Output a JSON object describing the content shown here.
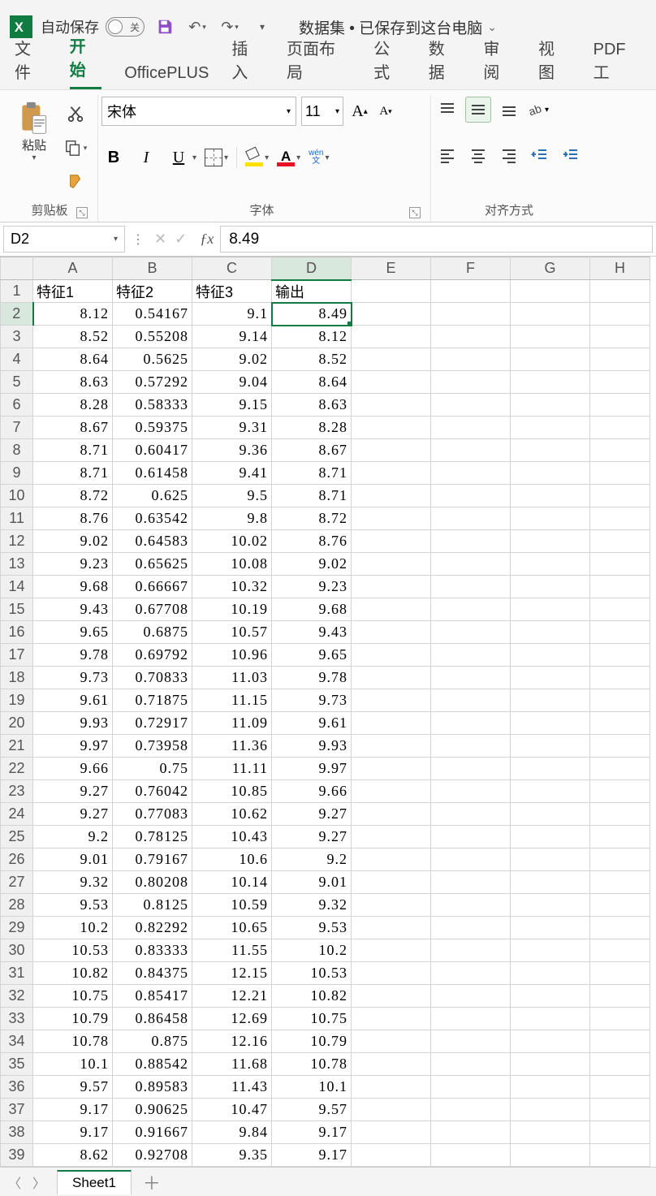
{
  "title": {
    "autosave_label": "自动保存",
    "autosave_state": "关",
    "doc_name": "数据集 • 已保存到这台电脑"
  },
  "tabs": {
    "file": "文件",
    "home": "开始",
    "officeplus": "OfficePLUS",
    "insert": "插入",
    "layout": "页面布局",
    "formulas": "公式",
    "data": "数据",
    "review": "审阅",
    "view": "视图",
    "pdf": "PDF工"
  },
  "ribbon": {
    "clipboard": {
      "paste": "粘贴",
      "group": "剪贴板"
    },
    "font": {
      "name": "宋体",
      "size": "11",
      "group": "字体",
      "wen_top": "wén",
      "wen_bot": "文"
    },
    "align": {
      "group": "对齐方式"
    }
  },
  "namebox": "D2",
  "formula": "8.49",
  "columns": [
    "A",
    "B",
    "C",
    "D",
    "E",
    "F",
    "G",
    "H"
  ],
  "headers": [
    "特征1",
    "特征2",
    "特征3",
    "输出"
  ],
  "rows": [
    [
      "8.12",
      "0.54167",
      "9.1",
      "8.49"
    ],
    [
      "8.52",
      "0.55208",
      "9.14",
      "8.12"
    ],
    [
      "8.64",
      "0.5625",
      "9.02",
      "8.52"
    ],
    [
      "8.63",
      "0.57292",
      "9.04",
      "8.64"
    ],
    [
      "8.28",
      "0.58333",
      "9.15",
      "8.63"
    ],
    [
      "8.67",
      "0.59375",
      "9.31",
      "8.28"
    ],
    [
      "8.71",
      "0.60417",
      "9.36",
      "8.67"
    ],
    [
      "8.71",
      "0.61458",
      "9.41",
      "8.71"
    ],
    [
      "8.72",
      "0.625",
      "9.5",
      "8.71"
    ],
    [
      "8.76",
      "0.63542",
      "9.8",
      "8.72"
    ],
    [
      "9.02",
      "0.64583",
      "10.02",
      "8.76"
    ],
    [
      "9.23",
      "0.65625",
      "10.08",
      "9.02"
    ],
    [
      "9.68",
      "0.66667",
      "10.32",
      "9.23"
    ],
    [
      "9.43",
      "0.67708",
      "10.19",
      "9.68"
    ],
    [
      "9.65",
      "0.6875",
      "10.57",
      "9.43"
    ],
    [
      "9.78",
      "0.69792",
      "10.96",
      "9.65"
    ],
    [
      "9.73",
      "0.70833",
      "11.03",
      "9.78"
    ],
    [
      "9.61",
      "0.71875",
      "11.15",
      "9.73"
    ],
    [
      "9.93",
      "0.72917",
      "11.09",
      "9.61"
    ],
    [
      "9.97",
      "0.73958",
      "11.36",
      "9.93"
    ],
    [
      "9.66",
      "0.75",
      "11.11",
      "9.97"
    ],
    [
      "9.27",
      "0.76042",
      "10.85",
      "9.66"
    ],
    [
      "9.27",
      "0.77083",
      "10.62",
      "9.27"
    ],
    [
      "9.2",
      "0.78125",
      "10.43",
      "9.27"
    ],
    [
      "9.01",
      "0.79167",
      "10.6",
      "9.2"
    ],
    [
      "9.32",
      "0.80208",
      "10.14",
      "9.01"
    ],
    [
      "9.53",
      "0.8125",
      "10.59",
      "9.32"
    ],
    [
      "10.2",
      "0.82292",
      "10.65",
      "9.53"
    ],
    [
      "10.53",
      "0.83333",
      "11.55",
      "10.2"
    ],
    [
      "10.82",
      "0.84375",
      "12.15",
      "10.53"
    ],
    [
      "10.75",
      "0.85417",
      "12.21",
      "10.82"
    ],
    [
      "10.79",
      "0.86458",
      "12.69",
      "10.75"
    ],
    [
      "10.78",
      "0.875",
      "12.16",
      "10.79"
    ],
    [
      "10.1",
      "0.88542",
      "11.68",
      "10.78"
    ],
    [
      "9.57",
      "0.89583",
      "11.43",
      "10.1"
    ],
    [
      "9.17",
      "0.90625",
      "10.47",
      "9.57"
    ],
    [
      "9.17",
      "0.91667",
      "9.84",
      "9.17"
    ],
    [
      "8.62",
      "0.92708",
      "9.35",
      "9.17"
    ]
  ],
  "selected": {
    "row": 2,
    "col": 4
  },
  "sheetbar": {
    "sheet1": "Sheet1"
  }
}
